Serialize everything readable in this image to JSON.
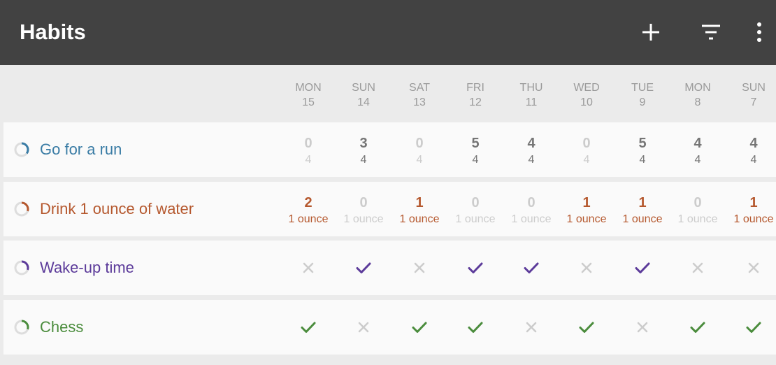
{
  "appbar": {
    "title": "Habits",
    "actions": [
      {
        "name": "add-icon"
      },
      {
        "name": "filter-icon"
      },
      {
        "name": "more-vert-icon"
      }
    ]
  },
  "days": [
    {
      "name": "MON",
      "date": "15"
    },
    {
      "name": "SUN",
      "date": "14"
    },
    {
      "name": "SAT",
      "date": "13"
    },
    {
      "name": "FRI",
      "date": "12"
    },
    {
      "name": "THU",
      "date": "11"
    },
    {
      "name": "WED",
      "date": "10"
    },
    {
      "name": "TUE",
      "date": "9"
    },
    {
      "name": "MON",
      "date": "8"
    },
    {
      "name": "SUN",
      "date": "7"
    }
  ],
  "colors": {
    "appbar": "#424242",
    "blue": "#3a7ca5",
    "orange": "#b5582e",
    "purple": "#5c3b9a",
    "green": "#4a8c3c",
    "muted": "#cccccc",
    "strong": "#757575"
  },
  "habits": [
    {
      "name": "Go for a run",
      "color": "#3a7ca5",
      "score": 0.35,
      "type": "numeric",
      "entries": [
        {
          "value": "0",
          "unit": "4",
          "done": false
        },
        {
          "value": "3",
          "unit": "4",
          "done": true
        },
        {
          "value": "0",
          "unit": "4",
          "done": false
        },
        {
          "value": "5",
          "unit": "4",
          "done": true
        },
        {
          "value": "4",
          "unit": "4",
          "done": true
        },
        {
          "value": "0",
          "unit": "4",
          "done": false
        },
        {
          "value": "5",
          "unit": "4",
          "done": true
        },
        {
          "value": "4",
          "unit": "4",
          "done": true
        },
        {
          "value": "4",
          "unit": "4",
          "done": true
        }
      ]
    },
    {
      "name": "Drink 1 ounce of water",
      "color": "#b5582e",
      "score": 0.3,
      "type": "numeric",
      "entries": [
        {
          "value": "2",
          "unit": "1 ounce",
          "done": true
        },
        {
          "value": "0",
          "unit": "1 ounce",
          "done": false
        },
        {
          "value": "1",
          "unit": "1 ounce",
          "done": true
        },
        {
          "value": "0",
          "unit": "1 ounce",
          "done": false
        },
        {
          "value": "0",
          "unit": "1 ounce",
          "done": false
        },
        {
          "value": "1",
          "unit": "1 ounce",
          "done": true
        },
        {
          "value": "1",
          "unit": "1 ounce",
          "done": true
        },
        {
          "value": "0",
          "unit": "1 ounce",
          "done": false
        },
        {
          "value": "1",
          "unit": "1 ounce",
          "done": true
        }
      ]
    },
    {
      "name": "Wake-up time",
      "color": "#5c3b9a",
      "score": 0.3,
      "type": "boolean",
      "entries": [
        false,
        true,
        false,
        true,
        true,
        false,
        true,
        false,
        false
      ]
    },
    {
      "name": "Chess",
      "color": "#4a8c3c",
      "score": 0.3,
      "type": "boolean",
      "entries": [
        true,
        false,
        true,
        true,
        false,
        true,
        false,
        true,
        true
      ]
    }
  ]
}
